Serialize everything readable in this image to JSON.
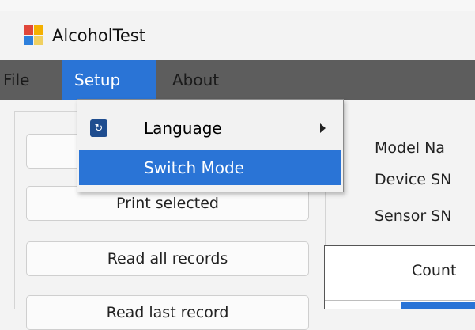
{
  "window": {
    "title": "AlcoholTest",
    "icon": "app-icon"
  },
  "menubar": {
    "items": [
      {
        "label": "File"
      },
      {
        "label": "Setup",
        "active": true
      },
      {
        "label": "About"
      }
    ]
  },
  "setup_menu": {
    "items": [
      {
        "label": "Language",
        "icon": "language-icon",
        "has_submenu": true
      },
      {
        "label": "Switch Mode",
        "highlighted": true
      }
    ]
  },
  "left_panel": {
    "buttons": [
      {
        "label": ""
      },
      {
        "label": "Print selected"
      },
      {
        "label": "Read all records"
      },
      {
        "label": "Read last record"
      }
    ]
  },
  "info": {
    "model_label": "Model Na",
    "device_sn_label": "Device SN",
    "sensor_sn_label": "Sensor SN"
  },
  "table": {
    "columns": [
      "",
      "Count"
    ]
  },
  "colors": {
    "accent": "#2a74d6",
    "menubar": "#5d5d5d"
  }
}
